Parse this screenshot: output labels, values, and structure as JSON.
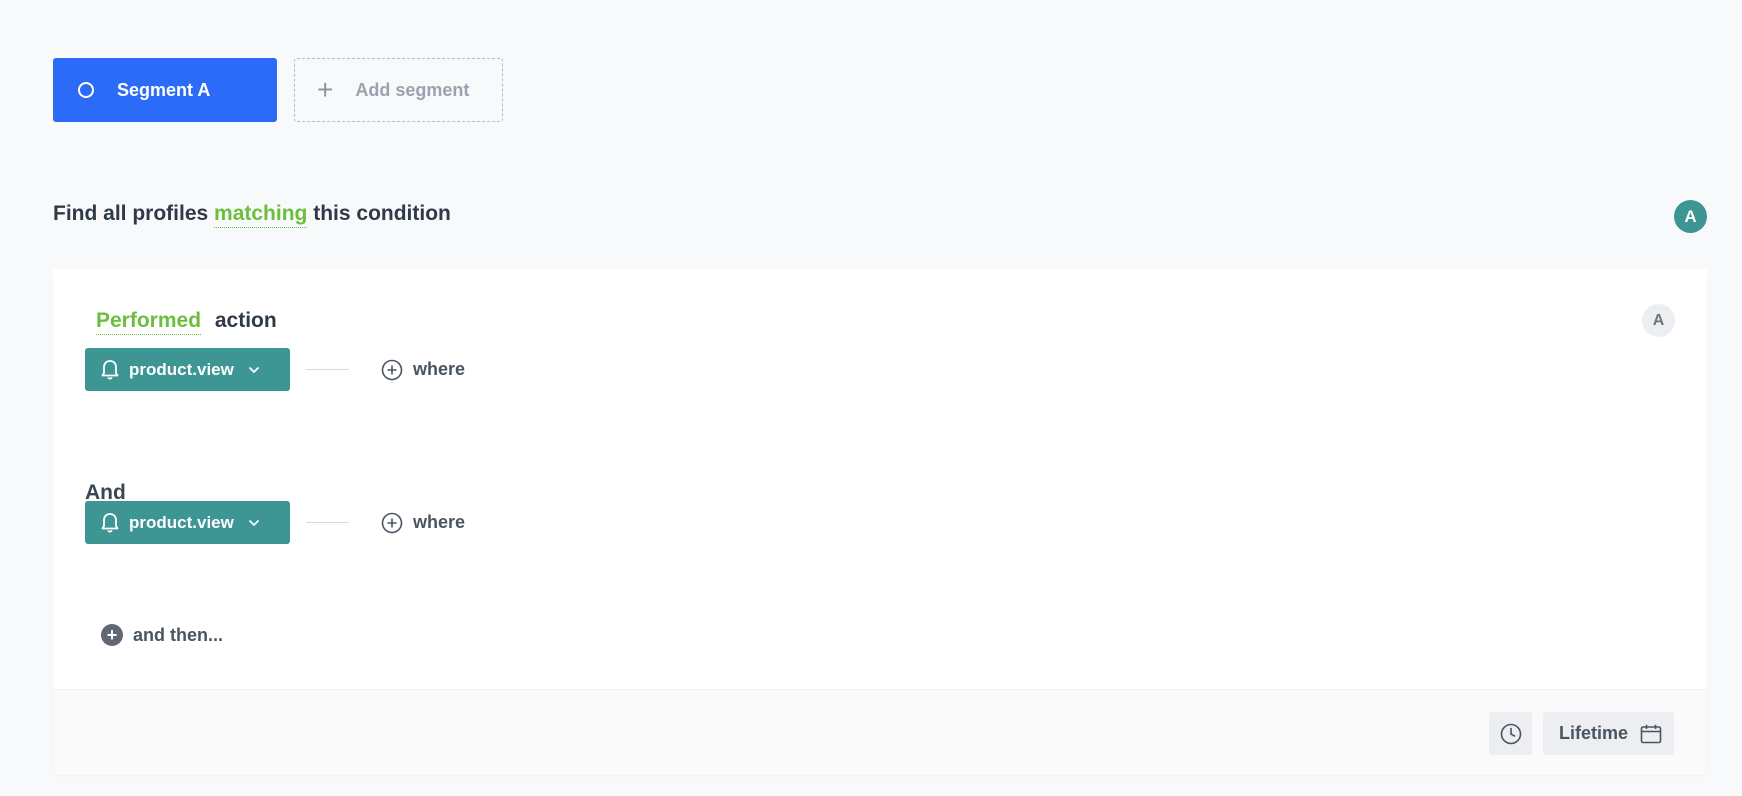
{
  "segments": {
    "active_label": "Segment A",
    "add_label": "Add segment"
  },
  "heading": {
    "prefix": "Find all profiles",
    "accent": "matching",
    "suffix": "this condition",
    "avatar": "A"
  },
  "condition": {
    "title_accent": "Performed",
    "title_rest": "action",
    "badge": "A",
    "events": [
      {
        "name": "product.view",
        "where_label": "where"
      },
      {
        "name": "product.view",
        "where_label": "where"
      }
    ],
    "joiner": "And",
    "and_then_label": "and then..."
  },
  "footer": {
    "time_range": "Lifetime"
  },
  "icons": {
    "segment": "circle-outline-icon",
    "add": "plus-icon",
    "event": "bell-icon",
    "dropdown": "chevron-down-icon",
    "where": "plus-circle-icon",
    "clock": "clock-icon",
    "calendar": "calendar-icon"
  },
  "colors": {
    "segment_blue": "#2c6bf8",
    "event_teal": "#3d9594",
    "accent_green": "#6cbf3c"
  }
}
